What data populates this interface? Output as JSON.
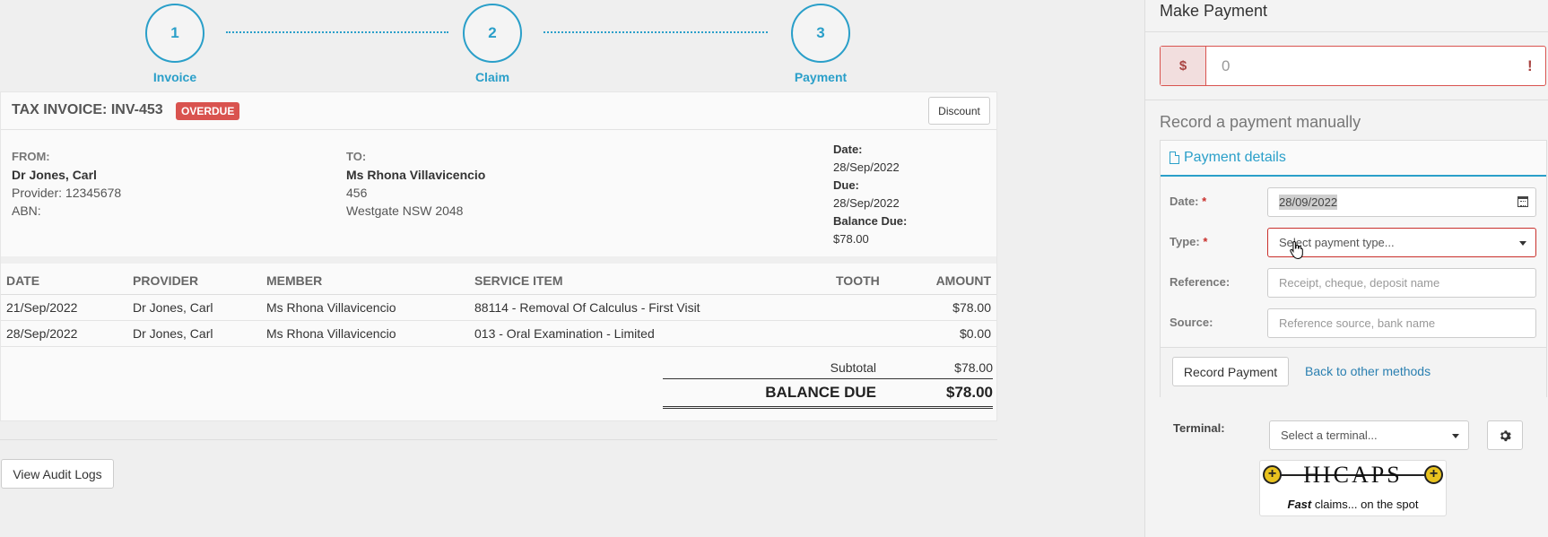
{
  "wizard": {
    "steps": [
      {
        "num": "1",
        "label": "Invoice"
      },
      {
        "num": "2",
        "label": "Claim"
      },
      {
        "num": "3",
        "label": "Payment"
      }
    ]
  },
  "invoice": {
    "title": "TAX INVOICE: INV-453",
    "status_badge": "OVERDUE",
    "discount_label": "Discount",
    "from": {
      "label": "FROM:",
      "name": "Dr Jones, Carl",
      "provider": "Provider: 12345678",
      "abn": "ABN:"
    },
    "to": {
      "label": "TO:",
      "name": "Ms Rhona Villavicencio",
      "line1": "456",
      "line2": "Westgate NSW 2048"
    },
    "dates": {
      "date_label": "Date:",
      "date": "28/Sep/2022",
      "due_label": "Due:",
      "due": "28/Sep/2022",
      "balance_label": "Balance Due:",
      "balance": "$78.00"
    },
    "columns": [
      "DATE",
      "PROVIDER",
      "MEMBER",
      "SERVICE ITEM",
      "TOOTH",
      "AMOUNT"
    ],
    "rows": [
      {
        "date": "21/Sep/2022",
        "provider": "Dr Jones, Carl",
        "member": "Ms Rhona Villavicencio",
        "service": "88114 - Removal Of Calculus - First Visit",
        "tooth": "",
        "amount": "$78.00"
      },
      {
        "date": "28/Sep/2022",
        "provider": "Dr Jones, Carl",
        "member": "Ms Rhona Villavicencio",
        "service": "013 - Oral Examination - Limited",
        "tooth": "",
        "amount": "$0.00"
      }
    ],
    "subtotal_label": "Subtotal",
    "subtotal": "$78.00",
    "balance_due_label": "BALANCE DUE",
    "balance_due": "$78.00",
    "audit_logs_label": "View Audit Logs"
  },
  "payment": {
    "title": "Make Payment",
    "currency_symbol": "$",
    "amount_value": "0",
    "amount_warning": "!",
    "manual_title": "Record a payment manually",
    "details_tab": "Payment details",
    "date_label": "Date:",
    "date_value": "28/09/2022",
    "type_label": "Type:",
    "type_placeholder": "Select payment type...",
    "reference_label": "Reference:",
    "reference_placeholder": "Receipt, cheque, deposit name",
    "source_label": "Source:",
    "source_placeholder": "Reference source, bank name",
    "required_mark": "*",
    "record_button": "Record Payment",
    "back_link": "Back to other methods",
    "terminal_label": "Terminal:",
    "terminal_placeholder": "Select a terminal...",
    "hicaps_logo": "HICAPS",
    "hicaps_tag_bold": "Fast",
    "hicaps_tag_rest": " claims... on the spot"
  },
  "colors": {
    "accent": "#2a9fc9",
    "danger": "#d9534f"
  }
}
